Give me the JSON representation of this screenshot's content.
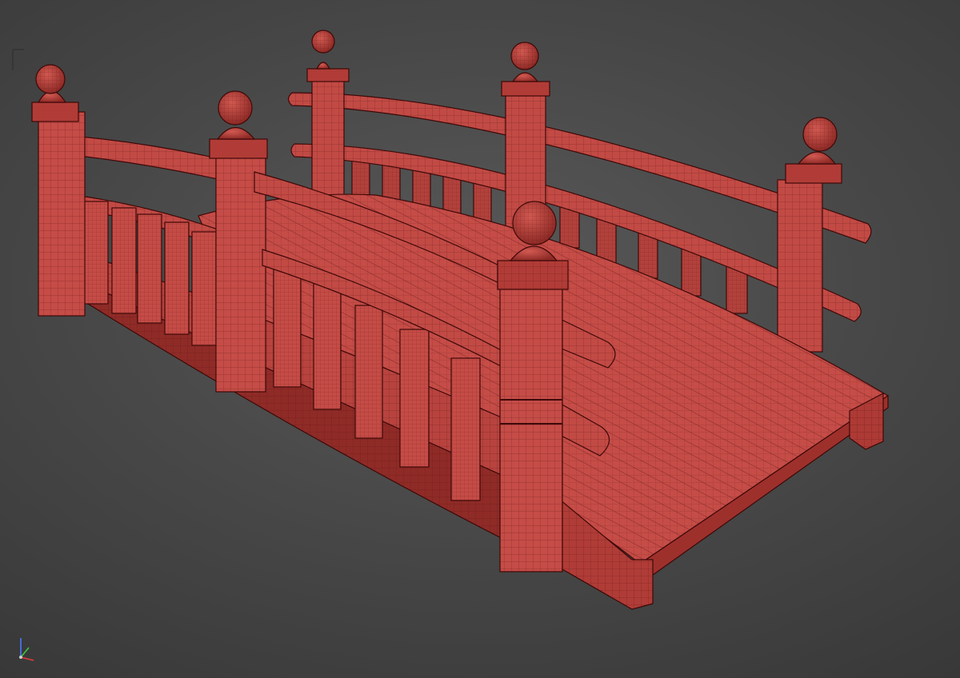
{
  "viewport": {
    "background": "#474747",
    "model": {
      "object": "japanese-arched-bridge",
      "display": "wireframe-on-shaded",
      "surface_color": "#c24a45",
      "wire_color": "#5e1412",
      "edge_color": "#3d0908"
    }
  },
  "gizmo": {
    "axes": [
      {
        "name": "x",
        "color": "#e03c3c"
      },
      {
        "name": "y",
        "color": "#3cc83c"
      },
      {
        "name": "z",
        "color": "#4a78ff"
      }
    ]
  },
  "icons": {
    "viewport_gizmo": "axis-tripod-icon",
    "crosshair": "crosshair-icon"
  }
}
